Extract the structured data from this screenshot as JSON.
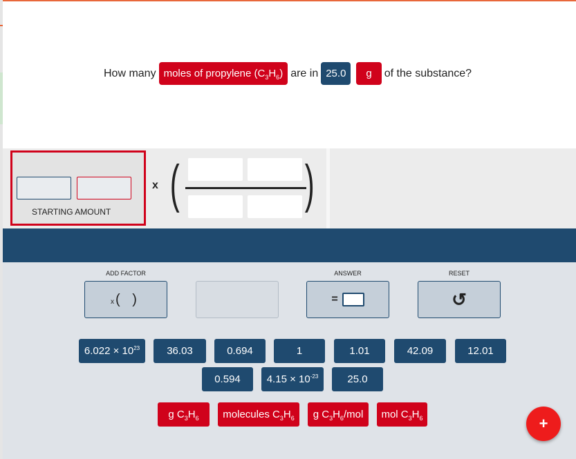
{
  "question": {
    "prefix": "How many",
    "target_unit": "moles of propylene (C",
    "target_sub1": "3",
    "target_mid": "H",
    "target_sub2": "6",
    "target_close": ")",
    "connector": "are in",
    "given_value": "25.0",
    "given_unit": "g",
    "suffix": "of the substance?"
  },
  "workspace": {
    "starting_amount_label": "STARTING AMOUNT",
    "times_symbol": "x",
    "left_paren": "(",
    "right_paren": ")"
  },
  "controls": {
    "add_factor_label": "ADD FACTOR",
    "add_factor_x": "x",
    "add_factor_parens": "( )",
    "answer_label": "ANSWER",
    "answer_equals": "=",
    "reset_label": "RESET",
    "reset_icon": "undo-icon"
  },
  "number_tiles_row1": [
    {
      "base": "6.022 × 10",
      "exp": "23"
    },
    {
      "base": "36.03",
      "exp": ""
    },
    {
      "base": "0.694",
      "exp": ""
    },
    {
      "base": "1",
      "exp": ""
    },
    {
      "base": "1.01",
      "exp": ""
    },
    {
      "base": "42.09",
      "exp": ""
    },
    {
      "base": "12.01",
      "exp": ""
    }
  ],
  "number_tiles_row2": [
    {
      "base": "0.594",
      "exp": ""
    },
    {
      "base": "4.15 × 10",
      "exp": "-23"
    },
    {
      "base": "25.0",
      "exp": ""
    }
  ],
  "unit_tiles": [
    {
      "pre": "g C",
      "s1": "3",
      "mid": "H",
      "s2": "6",
      "post": ""
    },
    {
      "pre": "molecules C",
      "s1": "3",
      "mid": "H",
      "s2": "6",
      "post": ""
    },
    {
      "pre": "g C",
      "s1": "3",
      "mid": "H",
      "s2": "6",
      "post": "/mol"
    },
    {
      "pre": "mol C",
      "s1": "3",
      "mid": "H",
      "s2": "6",
      "post": ""
    }
  ],
  "fab_label": "+",
  "colors": {
    "navy": "#1f4a6f",
    "red": "#d0021b",
    "fab": "#ee1c1c"
  }
}
